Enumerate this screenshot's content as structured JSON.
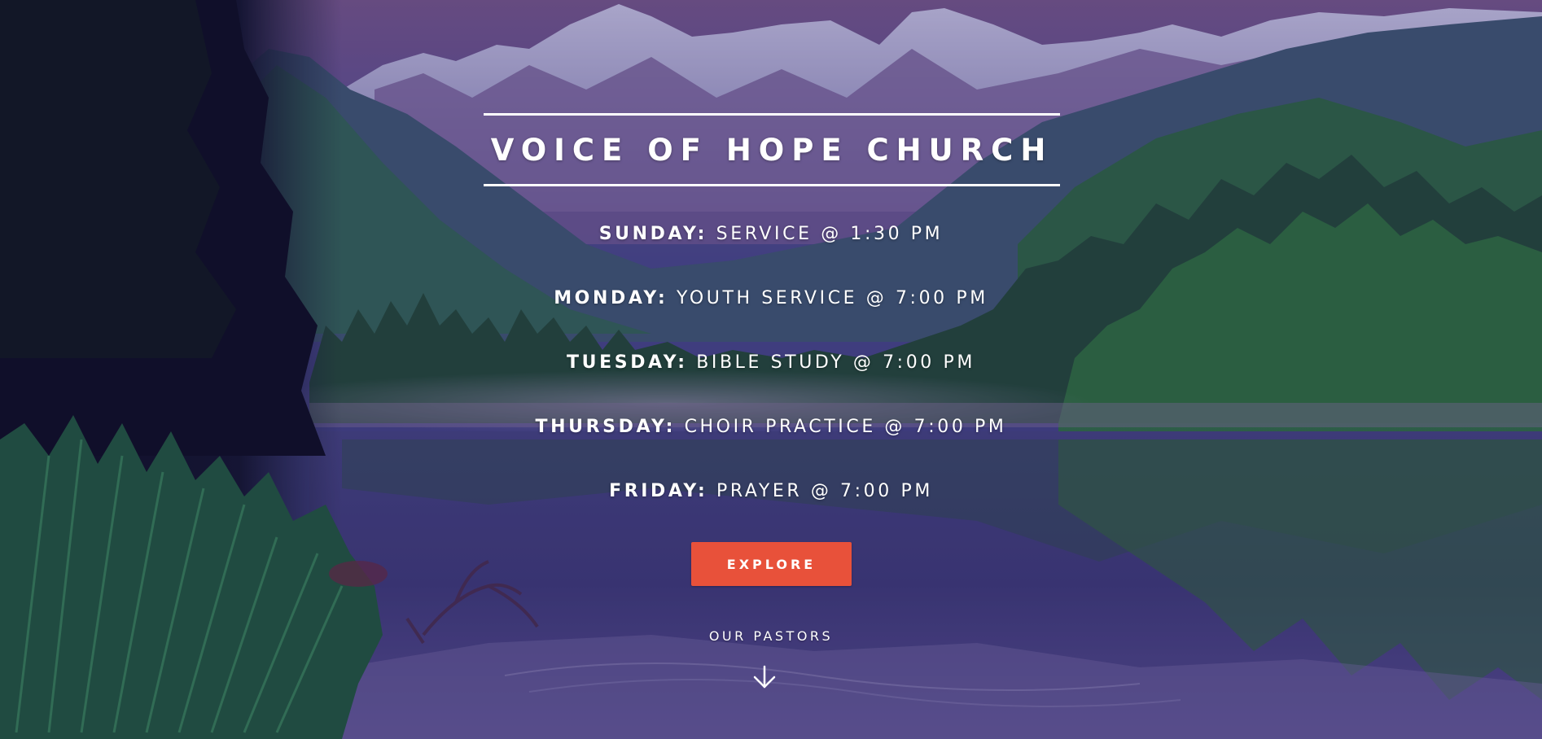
{
  "hero": {
    "title": "VOICE OF HOPE CHURCH",
    "schedule": [
      {
        "day": "SUNDAY:",
        "event": "SERVICE @ 1:30 PM"
      },
      {
        "day": "MONDAY:",
        "event": "YOUTH SERVICE @ 7:00 PM"
      },
      {
        "day": "TUESDAY:",
        "event": "BIBLE STUDY @ 7:00 PM"
      },
      {
        "day": "THURSDAY:",
        "event": "CHOIR PRACTICE @ 7:00 PM"
      },
      {
        "day": "FRIDAY:",
        "event": "PRAYER @ 7:00 PM"
      }
    ],
    "explore_label": "EXPLORE",
    "pastors_label": "OUR PASTORS",
    "scroll_icon": "arrow-down-icon"
  },
  "colors": {
    "accent": "#e8513a",
    "text": "#ffffff",
    "overlay": "#2a2368"
  }
}
